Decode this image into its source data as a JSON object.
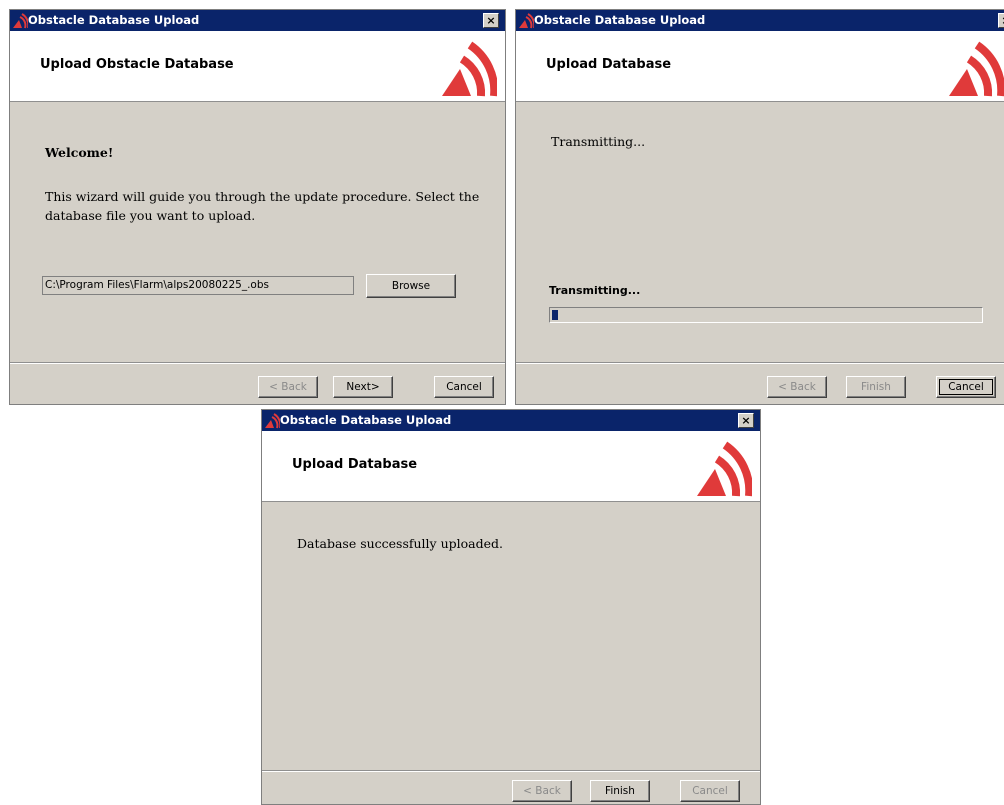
{
  "windows": [
    {
      "title": "Obstacle Database Upload",
      "close_glyph": "×",
      "header_title": "Upload Obstacle Database",
      "welcome": "Welcome!",
      "instructions_line1": "This wizard will guide you through the update procedure. Select the",
      "instructions_line2": "database file you want to upload.",
      "file_path": "C:\\Program Files\\Flarm\\alps20080225_.obs",
      "browse_label": "Browse",
      "back_label": "< Back",
      "next_label": "Next>",
      "cancel_label": "Cancel"
    },
    {
      "title": "Obstacle Database Upload",
      "close_glyph": "×",
      "header_title": "Upload Database",
      "message": "Transmitting...",
      "status_label": "Transmitting...",
      "progress": 0.012,
      "back_label": "< Back",
      "finish_label": "Finish",
      "cancel_label": "Cancel"
    },
    {
      "title": "Obstacle Database Upload",
      "close_glyph": "×",
      "header_title": "Upload Database",
      "message": "Database successfully uploaded.",
      "back_label": "< Back",
      "finish_label": "Finish",
      "cancel_label": "Cancel"
    }
  ],
  "icons": {
    "app": "flarm-logo-icon",
    "close": "close-icon",
    "header_logo": "flarm-logo-icon"
  },
  "colors": {
    "titlebar": "#0a246a",
    "dialog_bg": "#d4d0c8",
    "logo_red": "#e03a3a",
    "progress_fill": "#0a246a"
  }
}
